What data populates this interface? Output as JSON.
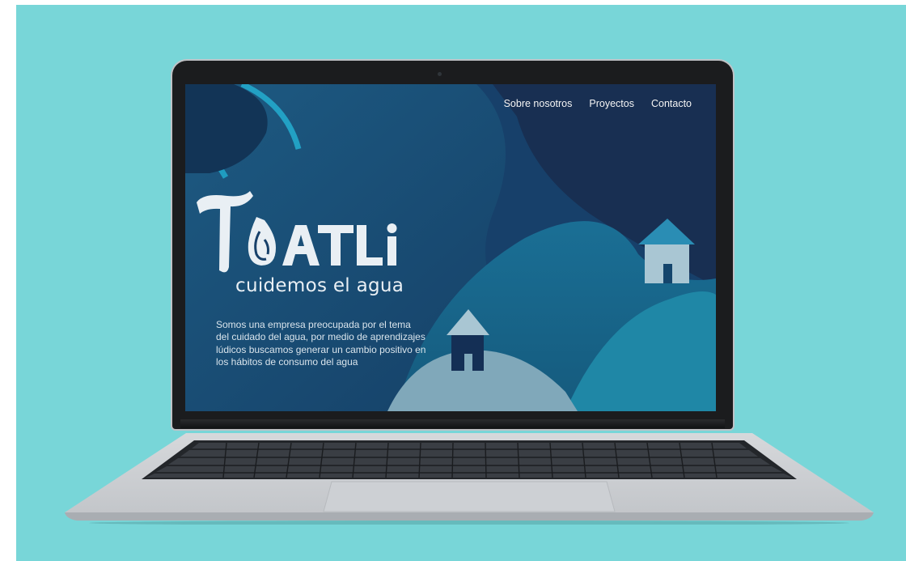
{
  "nav": {
    "items": [
      "Sobre nosotros",
      "Proyectos",
      "Contacto"
    ]
  },
  "hero": {
    "logo_text": "TOATLi",
    "tagline": "cuidemos el agua",
    "description": "Somos una empresa preocupada por el tema del cuidado del agua, por medio de aprendizajes lúdicos buscamos generar un cambio positivo en los hábitos de consumo del agua"
  },
  "colors": {
    "background": "#78d6d8",
    "screen_dark": "#143f63",
    "hill_light": "#7fa9bb",
    "accent_cyan": "#1aa8c4"
  },
  "icons": [
    "house-icon",
    "water-drop-icon"
  ]
}
